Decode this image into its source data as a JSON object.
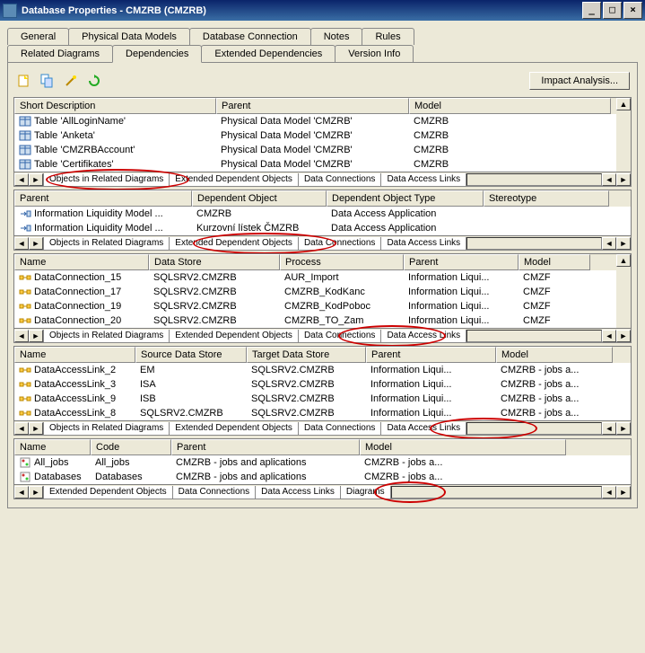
{
  "window": {
    "title": "Database Properties - CMZRB (CMZRB)"
  },
  "tabs_row1": [
    "General",
    "Physical Data Models",
    "Database Connection",
    "Notes",
    "Rules"
  ],
  "tabs_row2": [
    "Related Diagrams",
    "Dependencies",
    "Extended Dependencies",
    "Version Info"
  ],
  "active_tab": "Dependencies",
  "impact_btn": "Impact Analysis...",
  "pane1": {
    "headers": [
      "Short Description",
      "Parent",
      "Model"
    ],
    "rows": [
      {
        "sd": "Table 'AllLoginName'",
        "pa": "Physical Data Model 'CMZRB'",
        "md": "CMZRB"
      },
      {
        "sd": "Table 'Anketa'",
        "pa": "Physical Data Model 'CMZRB'",
        "md": "CMZRB"
      },
      {
        "sd": "Table 'CMZRBAccount'",
        "pa": "Physical Data Model 'CMZRB'",
        "md": "CMZRB"
      },
      {
        "sd": "Table 'Certifikates'",
        "pa": "Physical Data Model 'CMZRB'",
        "md": "CMZRB"
      }
    ],
    "subtabs": [
      "Objects in Related Diagrams",
      "Extended Dependent Objects",
      "Data Connections",
      "Data Access Links"
    ]
  },
  "pane2": {
    "headers": [
      "Parent",
      "Dependent Object",
      "Dependent Object Type",
      "Stereotype"
    ],
    "rows": [
      {
        "pa": "Information Liquidity Model ...",
        "do": "CMZRB",
        "dt": "Data Access Application",
        "st": ""
      },
      {
        "pa": "Information Liquidity Model ...",
        "do": "Kurzovní lístek ČMZRB",
        "dt": "Data Access Application",
        "st": ""
      }
    ],
    "subtabs": [
      "Objects in Related Diagrams",
      "Extended Dependent Objects",
      "Data Connections",
      "Data Access Links"
    ]
  },
  "pane3": {
    "headers": [
      "Name",
      "Data Store",
      "Process",
      "Parent",
      "Model"
    ],
    "rows": [
      {
        "nm": "DataConnection_15",
        "ds": "SQLSRV2.CMZRB",
        "pr": "AUR_Import",
        "pt": "Information Liqui...",
        "mo": "CMZF"
      },
      {
        "nm": "DataConnection_17",
        "ds": "SQLSRV2.CMZRB",
        "pr": "CMZRB_KodKanc",
        "pt": "Information Liqui...",
        "mo": "CMZF"
      },
      {
        "nm": "DataConnection_19",
        "ds": "SQLSRV2.CMZRB",
        "pr": "CMZRB_KodPoboc",
        "pt": "Information Liqui...",
        "mo": "CMZF"
      },
      {
        "nm": "DataConnection_20",
        "ds": "SQLSRV2.CMZRB",
        "pr": "CMZRB_TO_Zam",
        "pt": "Information Liqui...",
        "mo": "CMZF"
      }
    ],
    "subtabs": [
      "Objects in Related Diagrams",
      "Extended Dependent Objects",
      "Data Connections",
      "Data Access Links"
    ]
  },
  "pane4": {
    "headers": [
      "Name",
      "Source Data Store",
      "Target Data Store",
      "Parent",
      "Model"
    ],
    "rows": [
      {
        "nm": "DataAccessLink_2",
        "sds": "EM",
        "tds": "SQLSRV2.CMZRB",
        "pt": "Information Liqui...",
        "md": "CMZRB - jobs a..."
      },
      {
        "nm": "DataAccessLink_3",
        "sds": "ISA",
        "tds": "SQLSRV2.CMZRB",
        "pt": "Information Liqui...",
        "md": "CMZRB - jobs a..."
      },
      {
        "nm": "DataAccessLink_9",
        "sds": "ISB",
        "tds": "SQLSRV2.CMZRB",
        "pt": "Information Liqui...",
        "md": "CMZRB - jobs a..."
      },
      {
        "nm": "DataAccessLink_8",
        "sds": "SQLSRV2.CMZRB",
        "tds": "SQLSRV2.CMZRB",
        "pt": "Information Liqui...",
        "md": "CMZRB - jobs a..."
      }
    ],
    "subtabs": [
      "Objects in Related Diagrams",
      "Extended Dependent Objects",
      "Data Connections",
      "Data Access Links"
    ]
  },
  "pane5": {
    "headers": [
      "Name",
      "Code",
      "Parent",
      "Model"
    ],
    "rows": [
      {
        "nm": "All_jobs",
        "cd": "All_jobs",
        "pt": "CMZRB - jobs and aplications",
        "md": "CMZRB - jobs a..."
      },
      {
        "nm": "Databases",
        "cd": "Databases",
        "pt": "CMZRB - jobs and aplications",
        "md": "CMZRB - jobs a..."
      }
    ],
    "subtabs": [
      "Extended Dependent Objects",
      "Data Connections",
      "Data Access Links",
      "Diagrams"
    ]
  }
}
